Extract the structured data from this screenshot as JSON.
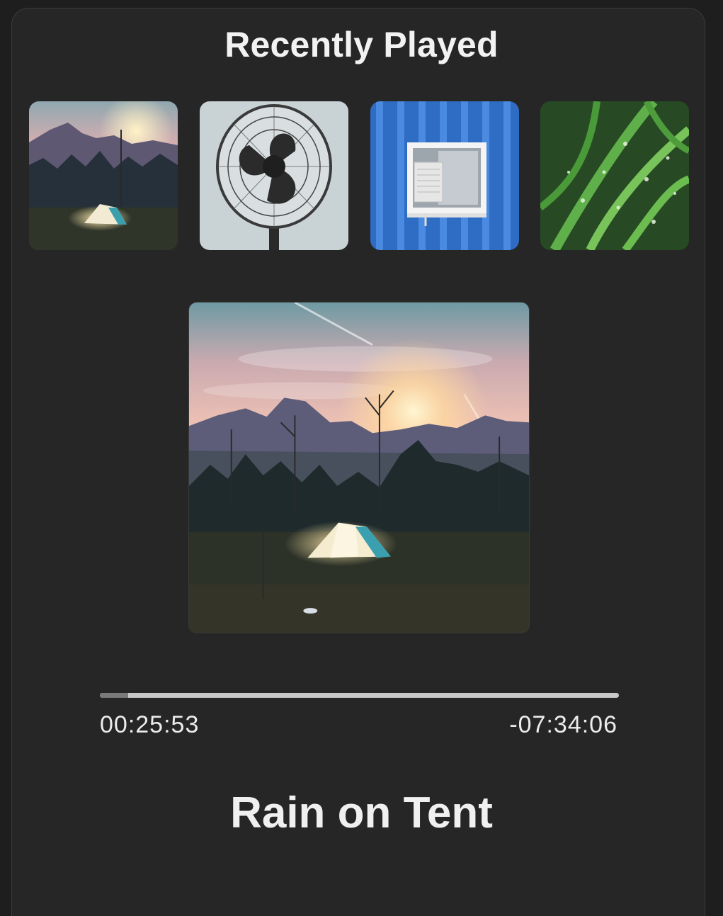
{
  "header": {
    "title": "Recently Played"
  },
  "recently_played": [
    {
      "icon": "tent-sunset-thumbnail"
    },
    {
      "icon": "electric-fan-thumbnail"
    },
    {
      "icon": "window-air-conditioner-thumbnail"
    },
    {
      "icon": "wet-grass-thumbnail"
    }
  ],
  "now_playing": {
    "artwork": "tent-sunset-artwork",
    "title": "Rain on Tent",
    "elapsed": "00:25:53",
    "remaining": "-07:34:06",
    "progress_fraction": 0.054
  },
  "colors": {
    "background": "#1e1e1e",
    "panel": "#262626",
    "track": "#c8c8c8",
    "track_fill": "#7a7a7a",
    "text": "#f2f2f2"
  }
}
